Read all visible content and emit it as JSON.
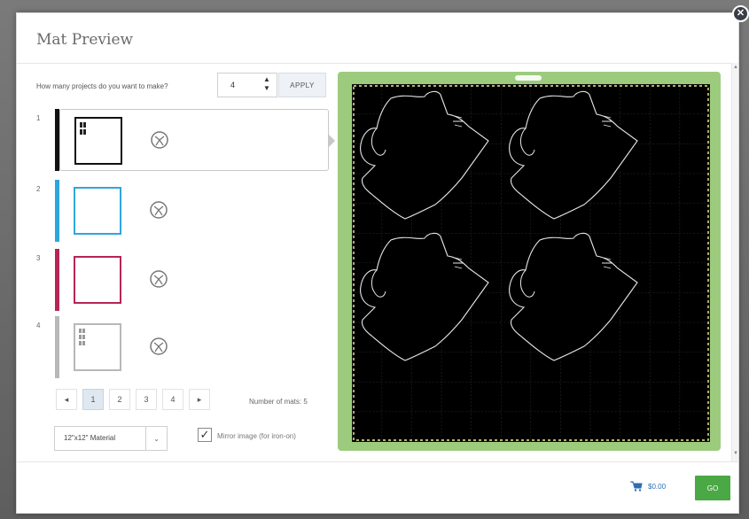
{
  "dialog": {
    "title": "Mat Preview"
  },
  "projects": {
    "question": "How many projects do you want to make?",
    "count": "4",
    "apply_label": "APPLY"
  },
  "mats": [
    {
      "number": "1",
      "color": "#111111",
      "thumb_border": "#111111",
      "selected": true
    },
    {
      "number": "2",
      "color": "#2ea6dd",
      "thumb_border": "#2ea6dd",
      "selected": false
    },
    {
      "number": "3",
      "color": "#b52555",
      "thumb_border": "#b52555",
      "selected": false
    },
    {
      "number": "4",
      "color": "#b8b8b8",
      "thumb_border": "#b8b8b8",
      "selected": false
    }
  ],
  "pagination": {
    "prev": "◂",
    "pages": [
      "1",
      "2",
      "3",
      "4"
    ],
    "next": "▸",
    "active_page": "1"
  },
  "mats_count": "Number of mats: 5",
  "material": {
    "label": "12\"x12\" Material",
    "caret": "⌄"
  },
  "mirror": {
    "checked": true,
    "label": "Mirror image (for iron-on)"
  },
  "cart": {
    "price": "$0.00"
  },
  "go_label": "GO",
  "colors": {
    "mat_green": "#9ccb7e",
    "go_green": "#4aa845",
    "link_blue": "#2f6db3"
  }
}
